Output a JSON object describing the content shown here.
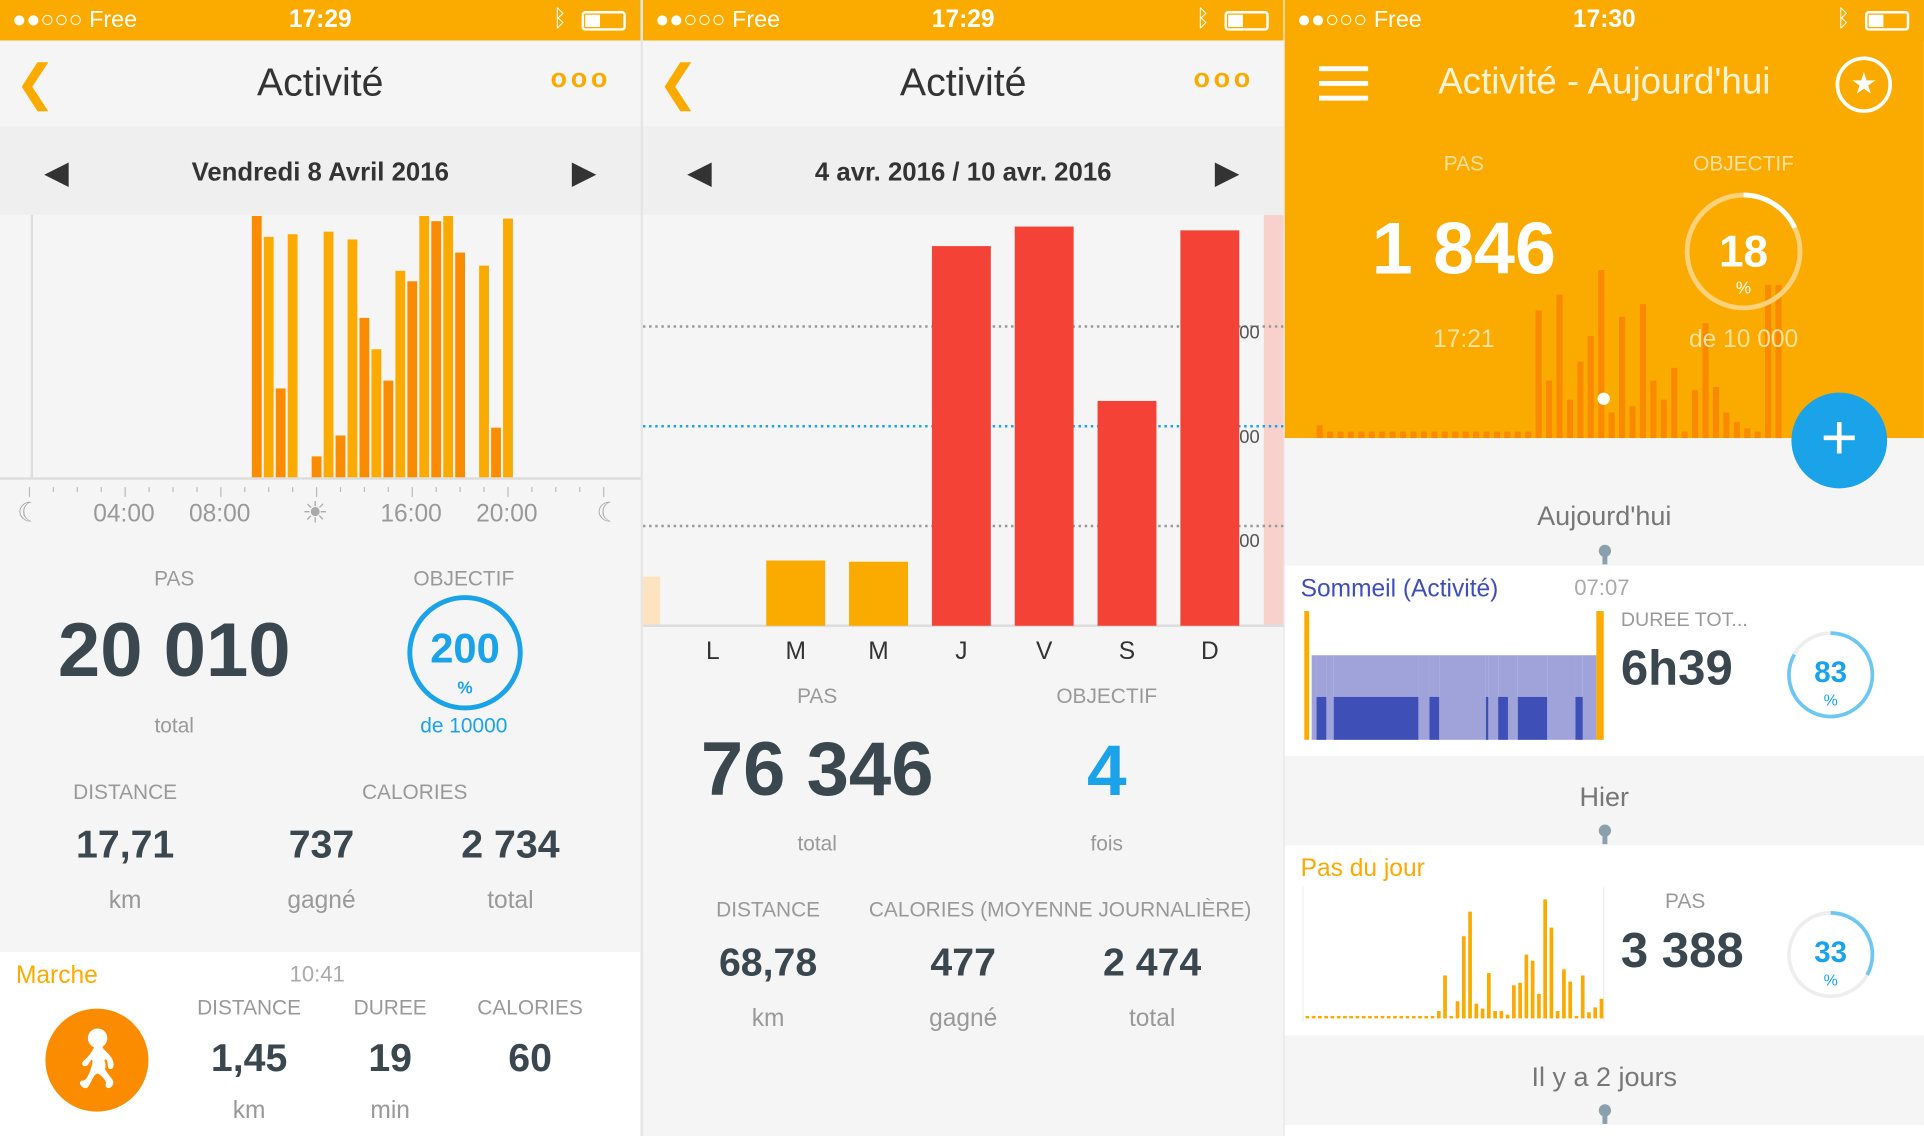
{
  "colors": {
    "orange": "#fbaa00",
    "bar_orange": "#fb8c00",
    "red": "#f44336",
    "blue": "#1aa3e8",
    "sleep_light": "#9fa3d9",
    "sleep_deep": "#3f4fb8"
  },
  "status_bars": [
    {
      "carrier": "●●○○○ Free",
      "time": "17:29"
    },
    {
      "carrier": "●●○○○ Free",
      "time": "17:29"
    },
    {
      "carrier": "●●○○○ Free",
      "time": "17:30"
    }
  ],
  "day": {
    "title": "Activité",
    "date": "Vendredi 8 Avril 2016",
    "axis_labels": [
      "04:00",
      "08:00",
      "16:00",
      "20:00"
    ],
    "steps_label": "PAS",
    "steps": "20 010",
    "steps_sub": "total",
    "goal_label": "OBJECTIF",
    "goal_pct": "200",
    "pct": "%",
    "goal_sub": "de 10000",
    "distance_label": "DISTANCE",
    "calories_label": "CALORIES",
    "distance": "17,71",
    "distance_unit": "km",
    "cal_gained": "737",
    "cal_gained_unit": "gagné",
    "cal_total": "2 734",
    "cal_total_unit": "total",
    "walk": {
      "label": "Marche",
      "time": "10:41",
      "distance_label": "DISTANCE",
      "duration_label": "DUREE",
      "calories_label": "CALORIES",
      "distance": "1,45",
      "distance_unit": "km",
      "duration": "19",
      "duration_unit": "min",
      "calories": "60"
    }
  },
  "week": {
    "title": "Activité",
    "date": "4 avr. 2016 / 10 avr. 2016",
    "y_tick_labels": [
      "00",
      "00",
      "00"
    ],
    "steps_label": "PAS",
    "steps": "76 346",
    "steps_sub": "total",
    "goal_label": "OBJECTIF",
    "goal_count": "4",
    "goal_sub": "fois",
    "distance_label": "DISTANCE",
    "calories_label": "CALORIES (MOYENNE JOURNALIÈRE)",
    "distance": "68,78",
    "distance_unit": "km",
    "cal_gained": "477",
    "cal_gained_unit": "gagné",
    "cal_total": "2 474",
    "cal_total_unit": "total"
  },
  "today": {
    "title": "Activité - Aujourd'hui",
    "steps_label": "PAS",
    "steps": "1 846",
    "steps_time": "17:21",
    "goal_label": "OBJECTIF",
    "goal_pct": "18",
    "pct": "%",
    "goal_sub": "de 10 000",
    "goal_fraction": 0.18,
    "sections": [
      "Aujourd'hui",
      "Hier",
      "Il y a 2 jours"
    ],
    "sleep": {
      "title": "Sommeil (Activité)",
      "time": "07:07",
      "label": "DUREE TOT...",
      "value": "6h39",
      "pct": "83",
      "pct_sign": "%",
      "fraction": 0.83
    },
    "steps_card": {
      "title": "Pas du jour",
      "label": "PAS",
      "value": "3 388",
      "pct": "33",
      "pct_sign": "%",
      "fraction": 0.33
    }
  },
  "chart_data": [
    {
      "type": "bar",
      "x_tick_labels": [
        "04:00",
        "08:00",
        "16:00",
        "20:00"
      ],
      "x_unit": "hour",
      "x": [
        9.5,
        10,
        10.5,
        11,
        12,
        12.5,
        13,
        13.5,
        14,
        14.5,
        15,
        15.5,
        16,
        16.5,
        17,
        17.5,
        18,
        19,
        19.5,
        20
      ],
      "values": [
        100,
        92,
        34,
        93,
        8,
        94,
        16,
        91,
        61,
        49,
        37,
        79,
        75,
        100,
        98,
        100,
        86,
        81,
        19,
        99
      ]
    },
    {
      "type": "bar",
      "categories": [
        "L",
        "M",
        "M",
        "J",
        "V",
        "S",
        "D"
      ],
      "values": [
        0,
        3270,
        3210,
        19030,
        20010,
        11270,
        19820
      ],
      "goal_line": 10000,
      "gridlines": [
        5000,
        10000,
        15000
      ],
      "ylim": [
        0,
        20500
      ]
    }
  ]
}
